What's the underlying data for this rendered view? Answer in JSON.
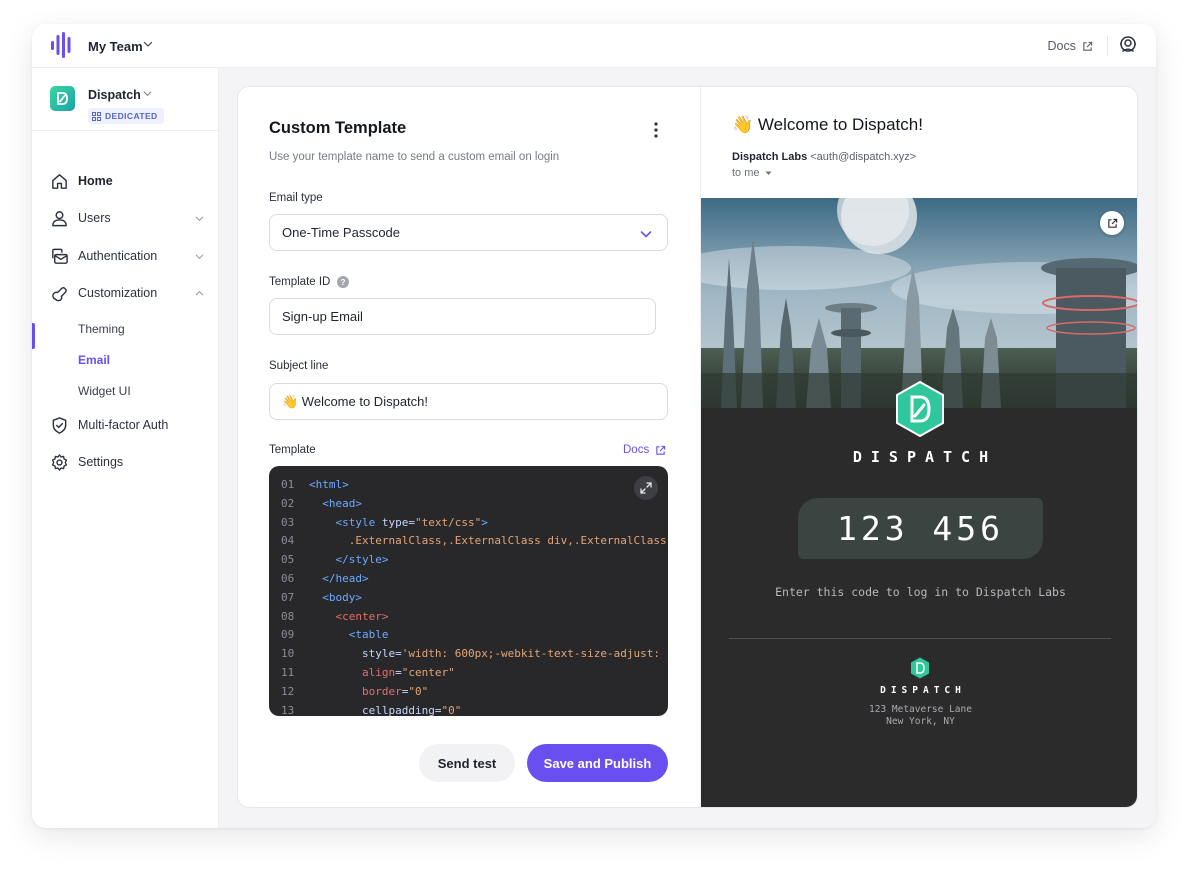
{
  "topbar": {
    "team_name": "My Team",
    "docs_label": "Docs"
  },
  "sidebar": {
    "app_name": "Dispatch",
    "app_badge": "DEDICATED",
    "items": [
      {
        "label": "Home",
        "icon": "home-icon",
        "active": true
      },
      {
        "label": "Users",
        "icon": "user-icon"
      },
      {
        "label": "Authentication",
        "icon": "authentication-icon"
      },
      {
        "label": "Customization",
        "icon": "customization-icon",
        "expanded": true
      },
      {
        "label": "Multi-factor Auth",
        "icon": "shield-icon"
      },
      {
        "label": "Settings",
        "icon": "gear-icon"
      }
    ],
    "sub_items": [
      {
        "label": "Theming"
      },
      {
        "label": "Email",
        "active": true
      },
      {
        "label": "Widget UI"
      }
    ]
  },
  "form": {
    "title": "Custom Template",
    "subtitle": "Use your template name to send a custom email on login",
    "email_type_label": "Email type",
    "email_type_value": "One-Time Passcode",
    "template_id_label": "Template ID",
    "template_id_value": "Sign-up Email",
    "subject_label": "Subject line",
    "subject_value": "👋 Welcome to Dispatch!",
    "template_label": "Template",
    "docs_label": "Docs",
    "code_lines": [
      {
        "n": "01",
        "parts": [
          {
            "t": "<html>",
            "c": "tag"
          }
        ]
      },
      {
        "n": "02",
        "parts": [
          {
            "t": "  <head>",
            "c": "tag"
          }
        ]
      },
      {
        "n": "03",
        "parts": [
          {
            "t": "    <style",
            "c": "tag"
          },
          {
            "t": " type",
            "c": "attr"
          },
          {
            "t": "=",
            "c": "attr"
          },
          {
            "t": "\"text/css\"",
            "c": "str"
          },
          {
            "t": ">",
            "c": "tag"
          }
        ]
      },
      {
        "n": "04",
        "parts": [
          {
            "t": "      .ExternalClass,.ExternalClass div,.ExternalClass",
            "c": "plain"
          }
        ]
      },
      {
        "n": "05",
        "parts": [
          {
            "t": "    </style>",
            "c": "tag"
          }
        ]
      },
      {
        "n": "06",
        "parts": [
          {
            "t": "  </head>",
            "c": "tag"
          }
        ]
      },
      {
        "n": "07",
        "parts": [
          {
            "t": "  <body>",
            "c": "tag"
          }
        ]
      },
      {
        "n": "08",
        "parts": [
          {
            "t": "    <center>",
            "c": "tag2"
          }
        ]
      },
      {
        "n": "09",
        "parts": [
          {
            "t": "      <table",
            "c": "tag"
          }
        ]
      },
      {
        "n": "10",
        "parts": [
          {
            "t": "        style",
            "c": "attr"
          },
          {
            "t": "=",
            "c": "attr"
          },
          {
            "t": "'width: 600px;-webkit-text-size-adjust:",
            "c": "str"
          }
        ]
      },
      {
        "n": "11",
        "parts": [
          {
            "t": "        align",
            "c": "attrr"
          },
          {
            "t": "=",
            "c": "attr"
          },
          {
            "t": "\"center\"",
            "c": "str"
          }
        ]
      },
      {
        "n": "12",
        "parts": [
          {
            "t": "        border",
            "c": "attrr"
          },
          {
            "t": "=",
            "c": "attr"
          },
          {
            "t": "\"0\"",
            "c": "str"
          }
        ]
      },
      {
        "n": "13",
        "parts": [
          {
            "t": "        cellpadding",
            "c": "attr"
          },
          {
            "t": "=",
            "c": "attr"
          },
          {
            "t": "\"0\"",
            "c": "str"
          }
        ]
      }
    ],
    "send_test_label": "Send test",
    "save_label": "Save and Publish"
  },
  "preview": {
    "subject": "👋 Welcome to Dispatch!",
    "from_name": "Dispatch Labs",
    "from_email": "<auth@dispatch.xyz>",
    "to": "to me",
    "brand": "DISPATCH",
    "otp": "123 456",
    "hint": "Enter this code to log in to Dispatch Labs",
    "footer_brand": "DISPATCH",
    "address_line1": "123 Metaverse Lane",
    "address_line2": "New York, NY"
  },
  "colors": {
    "accent": "#6a4ff0",
    "brand_green": "#2fc79b",
    "email_bg": "#2b2b2b",
    "code_bg": "#28282b"
  }
}
